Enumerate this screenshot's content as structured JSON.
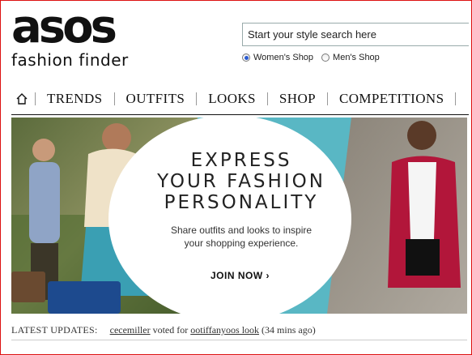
{
  "brand": {
    "logo_word": "asos",
    "logo_sub": "fashion finder"
  },
  "search": {
    "placeholder": "Start your style search here",
    "value": ""
  },
  "shop_options": [
    {
      "label": "Women's Shop",
      "selected": true
    },
    {
      "label": "Men's Shop",
      "selected": false
    }
  ],
  "nav": {
    "home_icon": "home-icon",
    "items": [
      "TRENDS",
      "OUTFITS",
      "LOOKS",
      "SHOP",
      "COMPETITIONS"
    ]
  },
  "hero": {
    "title_lines": [
      "EXPRESS",
      "YOUR FASHION",
      "PERSONALITY"
    ],
    "subtitle_lines": [
      "Share outfits and looks to inspire",
      "your shopping experience."
    ],
    "cta": "JOIN NOW ›"
  },
  "updates": {
    "label": "LATEST UPDATES:",
    "user": "cecemiller",
    "action": "voted for",
    "target": "ootiffanyoos look",
    "time": "(34 mins ago)"
  },
  "colors": {
    "frame": "#dd1111",
    "hero_bg": "#59b7c4",
    "radio_fill": "#2a5ad0"
  }
}
